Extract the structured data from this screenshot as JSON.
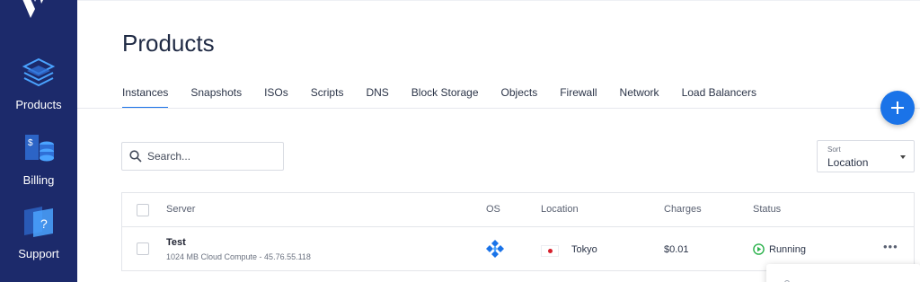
{
  "sidebar": {
    "items": [
      {
        "label": "Products",
        "icon": "products-layers-icon"
      },
      {
        "label": "Billing",
        "icon": "billing-coins-icon"
      },
      {
        "label": "Support",
        "icon": "support-question-icon"
      }
    ],
    "logo": "vultr-logo"
  },
  "header": {
    "title": "Products"
  },
  "tabs": [
    {
      "label": "Instances",
      "active": true
    },
    {
      "label": "Snapshots"
    },
    {
      "label": "ISOs"
    },
    {
      "label": "Scripts"
    },
    {
      "label": "DNS"
    },
    {
      "label": "Block Storage"
    },
    {
      "label": "Objects"
    },
    {
      "label": "Firewall"
    },
    {
      "label": "Network"
    },
    {
      "label": "Load Balancers"
    }
  ],
  "search": {
    "placeholder": "Search...",
    "value": ""
  },
  "sort": {
    "label": "Sort",
    "value": "Location"
  },
  "table": {
    "columns": [
      "Server",
      "OS",
      "Location",
      "Charges",
      "Status"
    ],
    "rows": [
      {
        "name": "Test",
        "description": "1024 MB Cloud Compute - 45.76.55.118",
        "os_icon": "os-icon",
        "location": "Tokyo",
        "flag": "japan-flag-icon",
        "charges": "$0.01",
        "status": "Running"
      }
    ]
  },
  "colors": {
    "sidebar_bg": "#1c2a6b",
    "accent": "#1a73e8",
    "running": "#2bb24c",
    "flag_red": "#d6202c"
  }
}
